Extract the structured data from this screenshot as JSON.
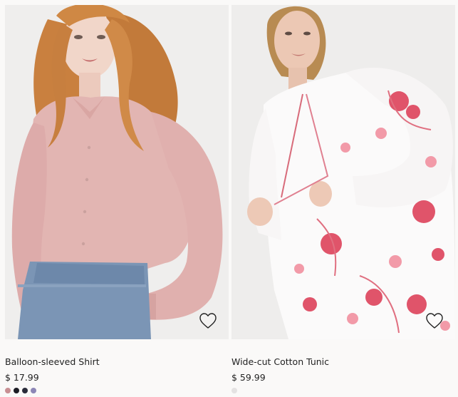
{
  "products": [
    {
      "name": "Balloon-sleeved Shirt",
      "price": "$ 17.99",
      "colors": [
        "#c88f93",
        "#1c1c24",
        "#2a2c3a",
        "#8c86b6"
      ],
      "favorite_icon": "heart-outline-icon"
    },
    {
      "name": "Wide-cut Cotton Tunic",
      "price": "$ 59.99",
      "colors": [
        "#e4e2e2"
      ],
      "favorite_icon": "heart-outline-icon"
    }
  ]
}
